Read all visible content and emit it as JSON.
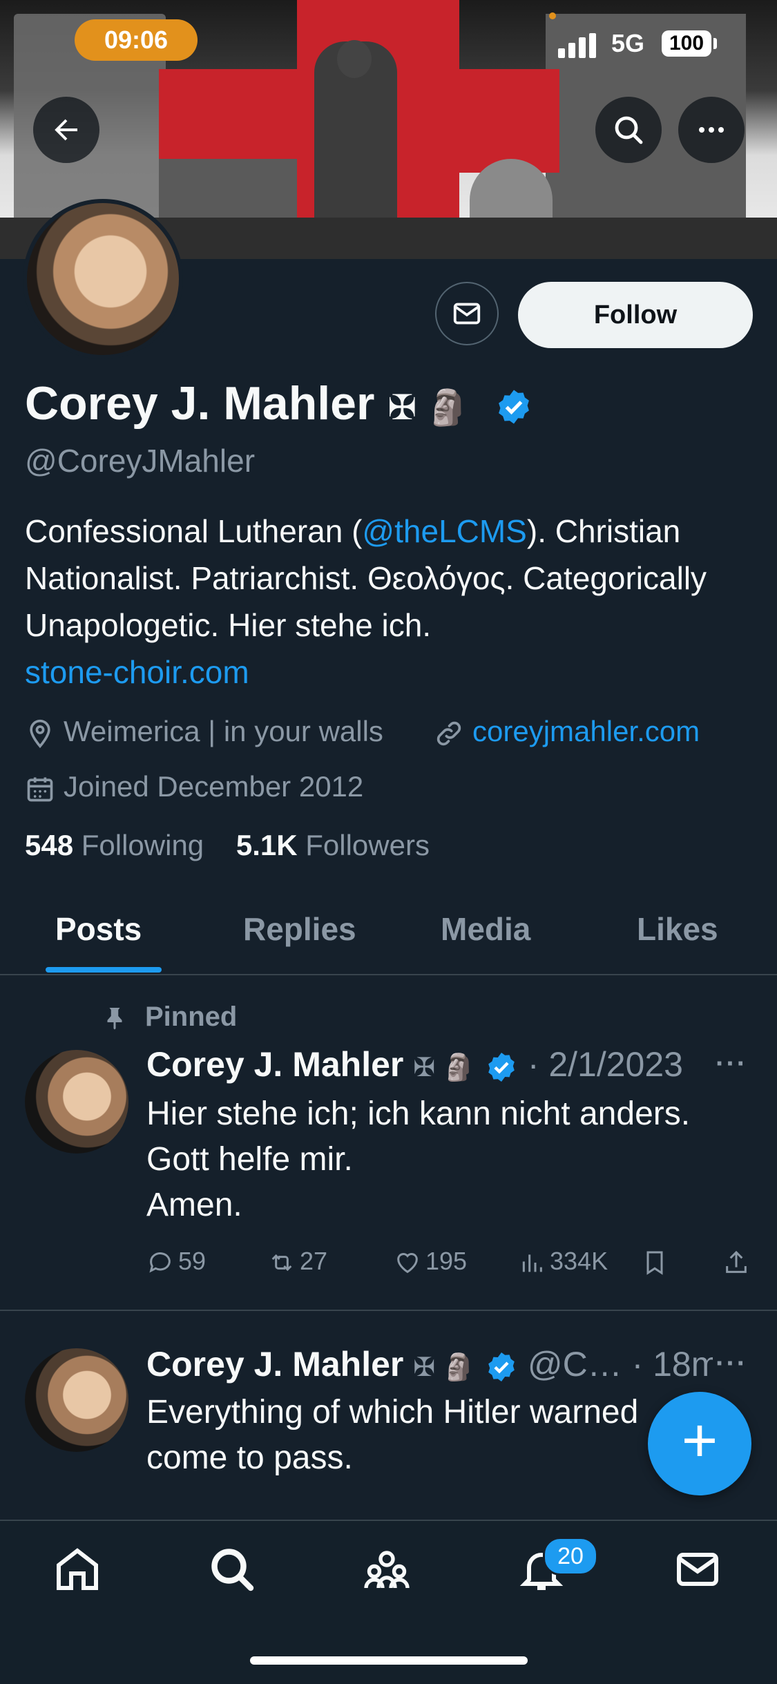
{
  "status_bar": {
    "time": "09:06",
    "network": "5G",
    "battery": "100"
  },
  "profile": {
    "name": "Corey J. Mahler",
    "name_suffix": "✠ 🗿",
    "handle": "@CoreyJMahler",
    "bio_part1": "Confessional Lutheran (",
    "bio_mention": "@theLCMS",
    "bio_part2": "). Christian Nationalist. Patriarchist. Θεολόγος. Categorically Unapologetic. Hier stehe ich.",
    "bio_link": "stone-choir.com",
    "location": "Weimerica | in your walls",
    "website": "coreyjmahler.com",
    "joined": "Joined December 2012",
    "following_count": "548",
    "following_label": "Following",
    "followers_count": "5.1K",
    "followers_label": "Followers",
    "follow_button": "Follow"
  },
  "tabs": [
    "Posts",
    "Replies",
    "Media",
    "Likes"
  ],
  "posts": [
    {
      "pinned_label": "Pinned",
      "author": "Corey J. Mahler",
      "author_suffix": "✠ 🗿",
      "meta": "· 2/1/2023",
      "text_line1": "Hier stehe ich; ich kann nicht anders.",
      "text_line2": "Gott helfe mir.",
      "text_line3": "Amen.",
      "replies": "59",
      "reposts": "27",
      "likes": "195",
      "views": "334K"
    },
    {
      "author": "Corey J. Mahler",
      "author_suffix": "✠ 🗿",
      "meta": "@C… · 18m",
      "text_line1": "Everything of which Hitler warned",
      "text_line2": "come to pass."
    }
  ],
  "nav": {
    "notification_badge": "20"
  },
  "colors": {
    "background": "#15202b",
    "accent": "#1d9bf0",
    "muted": "#8b98a5",
    "banner_red": "#c8232b"
  },
  "icons": [
    "back-arrow-icon",
    "search-icon",
    "more-icon",
    "mail-icon",
    "verified-icon",
    "location-icon",
    "link-icon",
    "calendar-icon",
    "pin-icon",
    "reply-icon",
    "repost-icon",
    "like-icon",
    "views-icon",
    "bookmark-icon",
    "share-icon",
    "compose-plus-icon",
    "home-icon",
    "explore-search-icon",
    "communities-icon",
    "notifications-icon",
    "messages-icon"
  ]
}
